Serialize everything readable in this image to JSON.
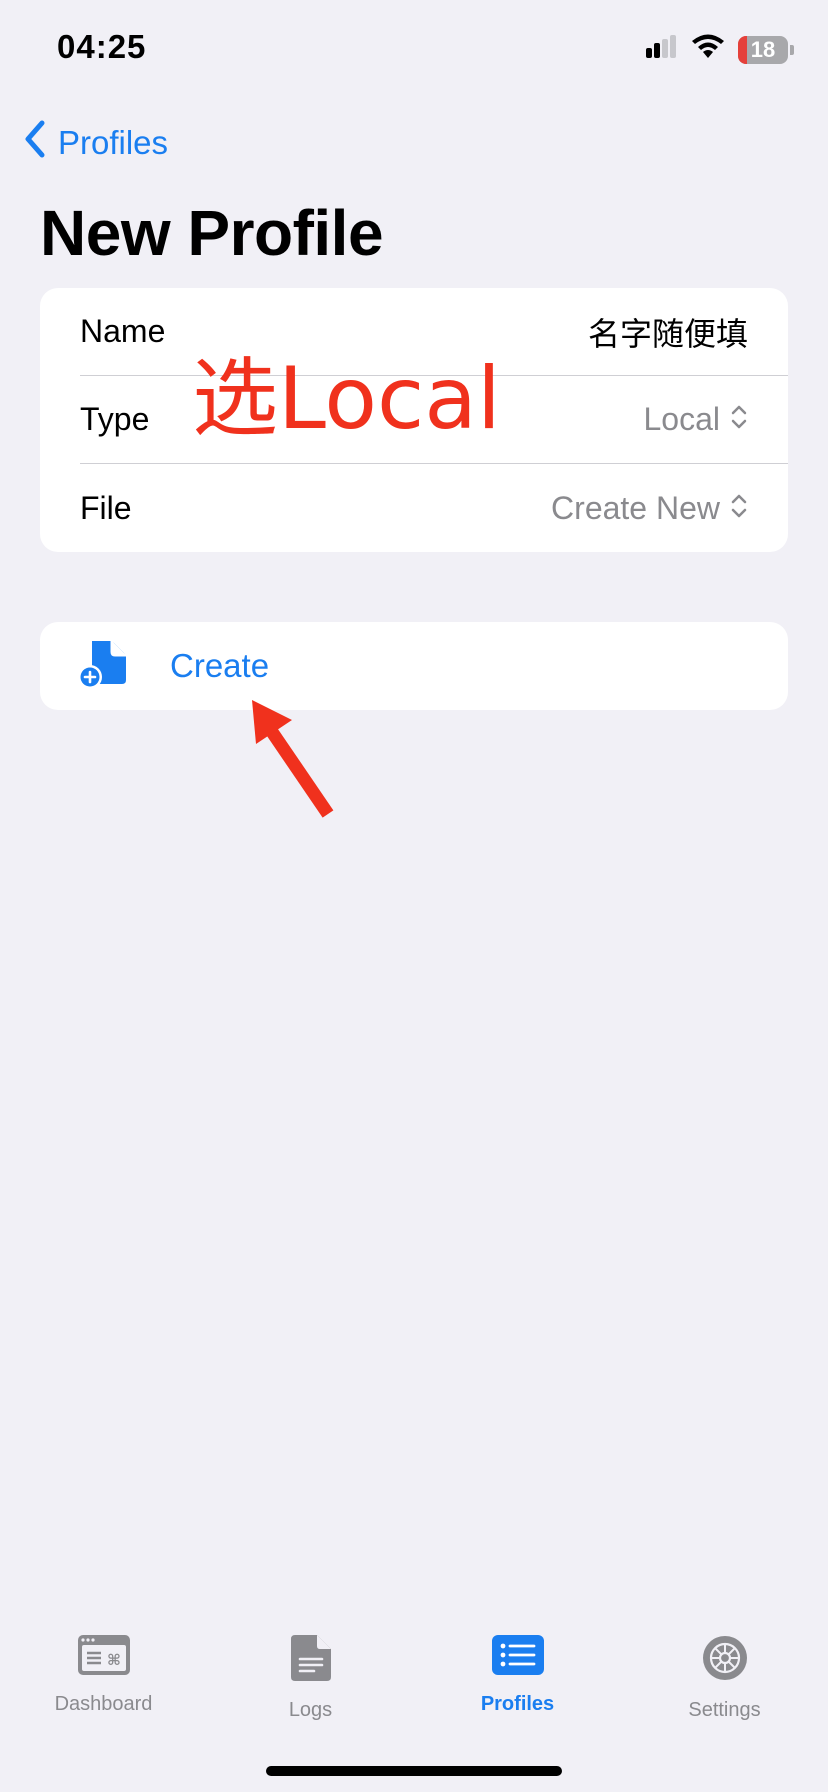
{
  "status_bar": {
    "time": "04:25",
    "battery_level": "18",
    "battery_fraction": 0.18,
    "icons": [
      "signal-icon",
      "wifi-icon",
      "battery-icon"
    ]
  },
  "nav": {
    "back_label": "Profiles",
    "title": "New Profile"
  },
  "form": {
    "name_label": "Name",
    "name_value": "名字随便填",
    "type_label": "Type",
    "type_value": "Local",
    "file_label": "File",
    "file_value": "Create New"
  },
  "action": {
    "create_label": "Create",
    "icon": "doc-badge-plus-icon"
  },
  "annotation": {
    "text": "选Local"
  },
  "tabs": [
    {
      "label": "Dashboard",
      "icon": "dashboard-icon"
    },
    {
      "label": "Logs",
      "icon": "logs-icon"
    },
    {
      "label": "Profiles",
      "icon": "profiles-icon"
    },
    {
      "label": "Settings",
      "icon": "settings-gear-icon"
    }
  ],
  "colors": {
    "accent": "#1a7ef0",
    "annotation": "#f0311d",
    "background": "#f1f0f6",
    "secondary_text": "#8a8a8e"
  }
}
